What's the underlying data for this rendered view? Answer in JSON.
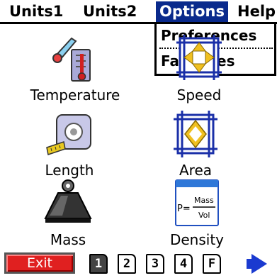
{
  "menubar": {
    "items": [
      {
        "label": "Units1"
      },
      {
        "label": "Units2"
      },
      {
        "label": "Options"
      },
      {
        "label": "Help"
      }
    ]
  },
  "dropdown": {
    "items": [
      {
        "label": "Preferences"
      },
      {
        "label": "Favorites"
      }
    ]
  },
  "categories": [
    {
      "label": "Temperature",
      "icon": "thermometer-icon"
    },
    {
      "label": "Speed",
      "icon": "speed-arrows-icon"
    },
    {
      "label": "Length",
      "icon": "tape-measure-icon"
    },
    {
      "label": "Area",
      "icon": "area-icon"
    },
    {
      "label": "Mass",
      "icon": "weight-icon"
    },
    {
      "label": "Density",
      "icon": "density-formula-icon"
    }
  ],
  "density_icon": {
    "p": "P=",
    "num": "Mass",
    "den": "Vol"
  },
  "bottombar": {
    "exit_label": "Exit",
    "pages": [
      "1",
      "2",
      "3",
      "4",
      "F"
    ],
    "selected_page": "1"
  },
  "colors": {
    "menu_highlight": "#0a2a8c",
    "exit_button": "#e02020",
    "nav_arrow": "#1a3ad0"
  }
}
